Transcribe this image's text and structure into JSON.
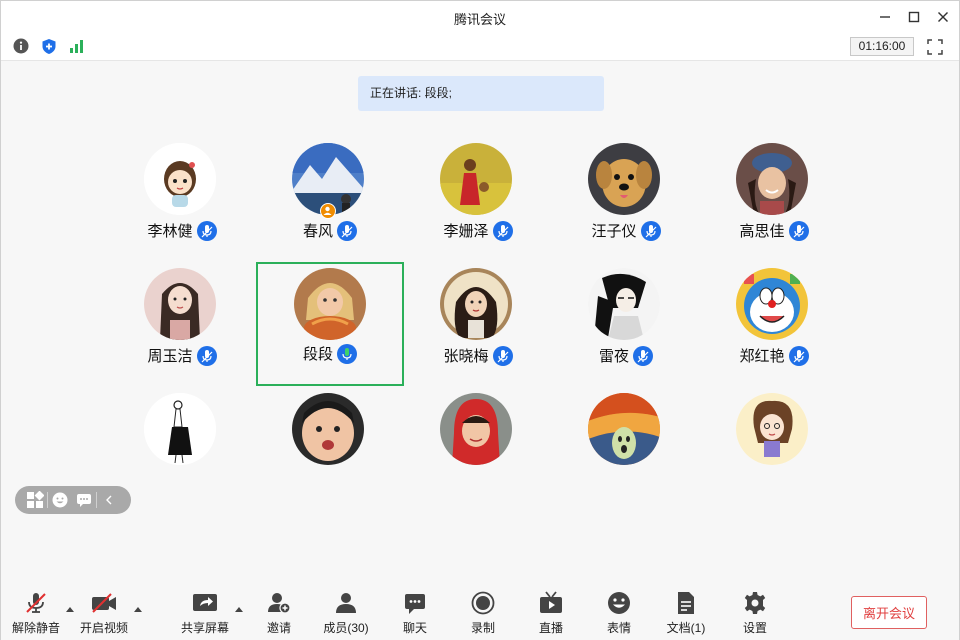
{
  "window": {
    "title": "腾讯会议"
  },
  "infobar": {
    "timer": "01:16:00"
  },
  "speaking": {
    "text": "正在讲话: 段段;"
  },
  "participants": [
    {
      "name": "李林健",
      "avatar": "cartoon-girl"
    },
    {
      "name": "春风",
      "avatar": "mountain-lake",
      "host": true
    },
    {
      "name": "李姗泽",
      "avatar": "girl-in-field"
    },
    {
      "name": "汪子仪",
      "avatar": "puppy"
    },
    {
      "name": "高思佳",
      "avatar": "girl-with-hat"
    },
    {
      "name": "周玉洁",
      "avatar": "illustrated-woman"
    },
    {
      "name": "段段",
      "avatar": "little-girl-eating",
      "active": true
    },
    {
      "name": "张晓梅",
      "avatar": "art-portrait"
    },
    {
      "name": "雷夜",
      "avatar": "ink-character"
    },
    {
      "name": "郑红艳",
      "avatar": "doraemon"
    },
    {
      "name": "",
      "avatar": "sketch-figure"
    },
    {
      "name": "",
      "avatar": "child-face"
    },
    {
      "name": "",
      "avatar": "red-hood-girl"
    },
    {
      "name": "",
      "avatar": "scream-painting"
    },
    {
      "name": "",
      "avatar": "cartoon-lady"
    }
  ],
  "toolbar": {
    "unmute": "解除静音",
    "start_video": "开启视频",
    "share_screen": "共享屏幕",
    "invite": "邀请",
    "members": "成员(30)",
    "chat": "聊天",
    "record": "录制",
    "live": "直播",
    "emoji": "表情",
    "docs": "文档(1)",
    "settings": "设置",
    "leave": "离开会议"
  },
  "colors": {
    "accent": "#1f6fe8",
    "active_border": "#2bb05a",
    "leave": "#e04040",
    "banner": "#dbe8fb"
  }
}
